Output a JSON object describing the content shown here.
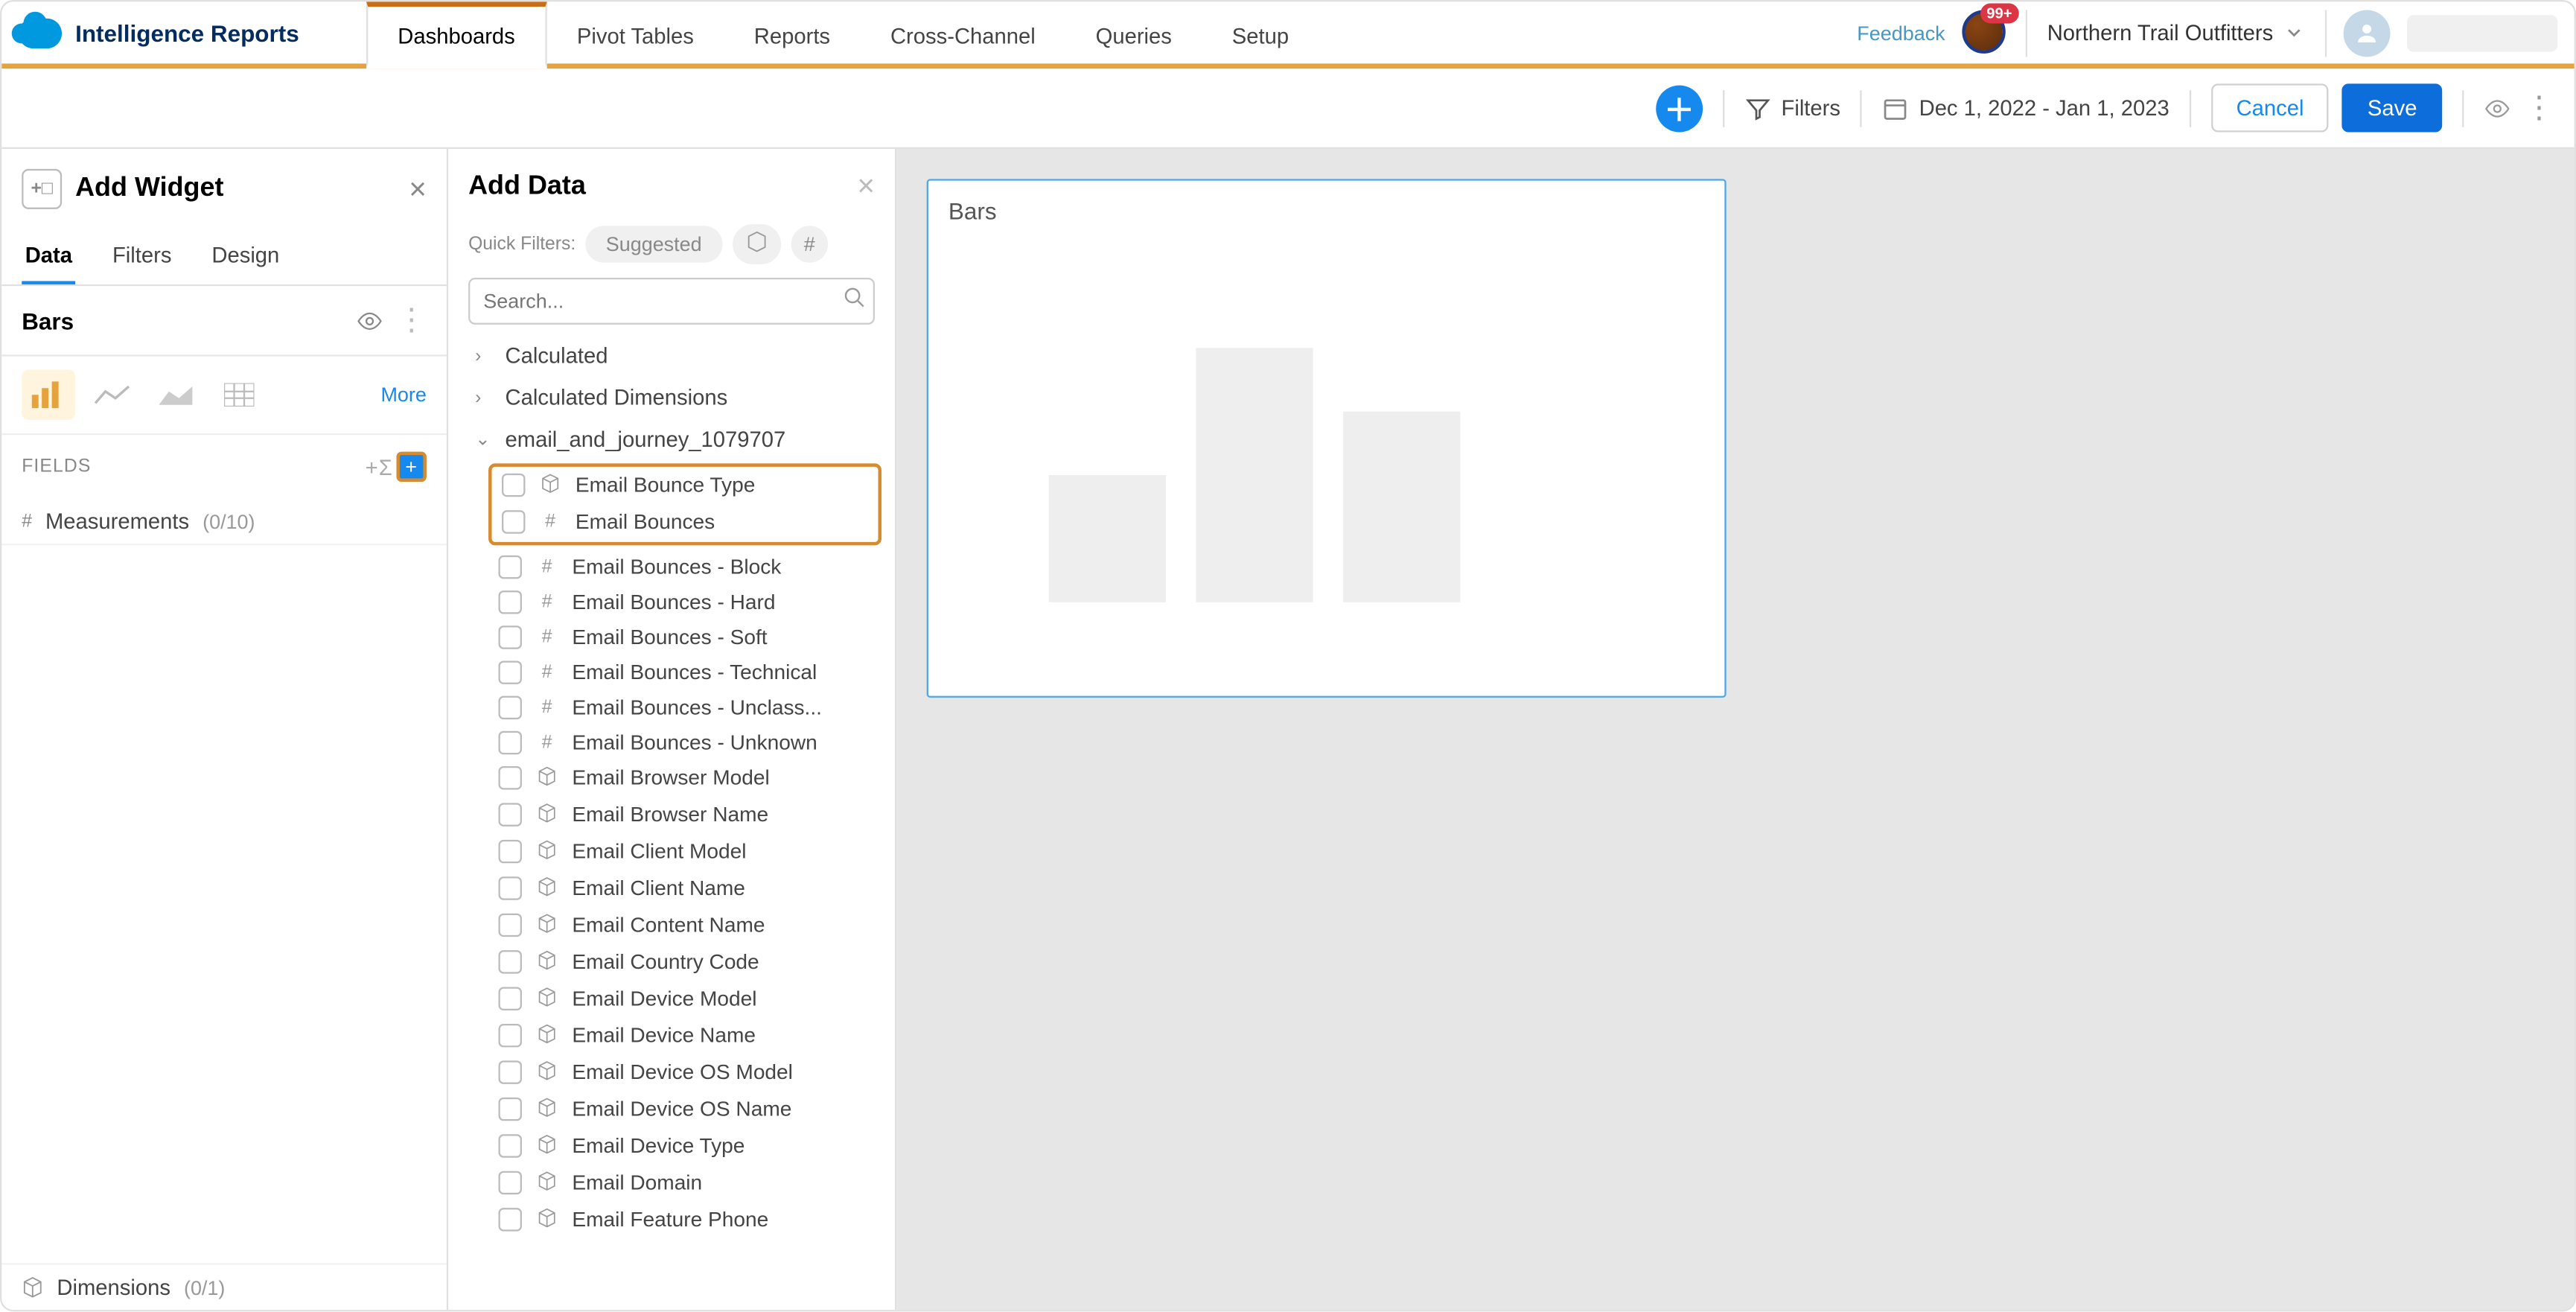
{
  "brand": "Intelligence Reports",
  "nav": {
    "tabs": [
      "Dashboards",
      "Pivot Tables",
      "Reports",
      "Cross-Channel",
      "Queries",
      "Setup"
    ],
    "active": 0,
    "feedback": "Feedback",
    "bell_badge": "99+",
    "org": "Northern Trail Outfitters"
  },
  "toolbar": {
    "filters": "Filters",
    "date_range": "Dec 1, 2022 - Jan 1, 2023",
    "cancel": "Cancel",
    "save": "Save"
  },
  "add_widget": {
    "title": "Add Widget",
    "tabs": [
      "Data",
      "Filters",
      "Design"
    ],
    "active_tab": 0,
    "widget_name": "Bars",
    "more": "More",
    "fields_label": "FIELDS",
    "measurements_label": "Measurements",
    "measurements_count": "(0/10)",
    "dimensions_label": "Dimensions",
    "dimensions_count": "(0/1)"
  },
  "add_data": {
    "title": "Add Data",
    "quick_label": "Quick Filters:",
    "suggested": "Suggested",
    "search_placeholder": "Search...",
    "categories": [
      {
        "label": "Calculated",
        "expanded": false
      },
      {
        "label": "Calculated Dimensions",
        "expanded": false
      },
      {
        "label": "email_and_journey_1079707",
        "expanded": true
      }
    ],
    "highlighted_fields": [
      {
        "type": "dim",
        "label": "Email Bounce Type"
      },
      {
        "type": "num",
        "label": "Email Bounces"
      }
    ],
    "fields": [
      {
        "type": "num",
        "label": "Email Bounces - Block"
      },
      {
        "type": "num",
        "label": "Email Bounces - Hard"
      },
      {
        "type": "num",
        "label": "Email Bounces - Soft"
      },
      {
        "type": "num",
        "label": "Email Bounces - Technical"
      },
      {
        "type": "num",
        "label": "Email Bounces - Unclass..."
      },
      {
        "type": "num",
        "label": "Email Bounces - Unknown"
      },
      {
        "type": "dim",
        "label": "Email Browser Model"
      },
      {
        "type": "dim",
        "label": "Email Browser Name"
      },
      {
        "type": "dim",
        "label": "Email Client Model"
      },
      {
        "type": "dim",
        "label": "Email Client Name"
      },
      {
        "type": "dim",
        "label": "Email Content Name"
      },
      {
        "type": "dim",
        "label": "Email Country Code"
      },
      {
        "type": "dim",
        "label": "Email Device Model"
      },
      {
        "type": "dim",
        "label": "Email Device Name"
      },
      {
        "type": "dim",
        "label": "Email Device OS Model"
      },
      {
        "type": "dim",
        "label": "Email Device OS Name"
      },
      {
        "type": "dim",
        "label": "Email Device Type"
      },
      {
        "type": "dim",
        "label": "Email Domain"
      },
      {
        "type": "dim",
        "label": "Email Feature Phone"
      }
    ]
  },
  "canvas": {
    "widget_title": "Bars"
  }
}
